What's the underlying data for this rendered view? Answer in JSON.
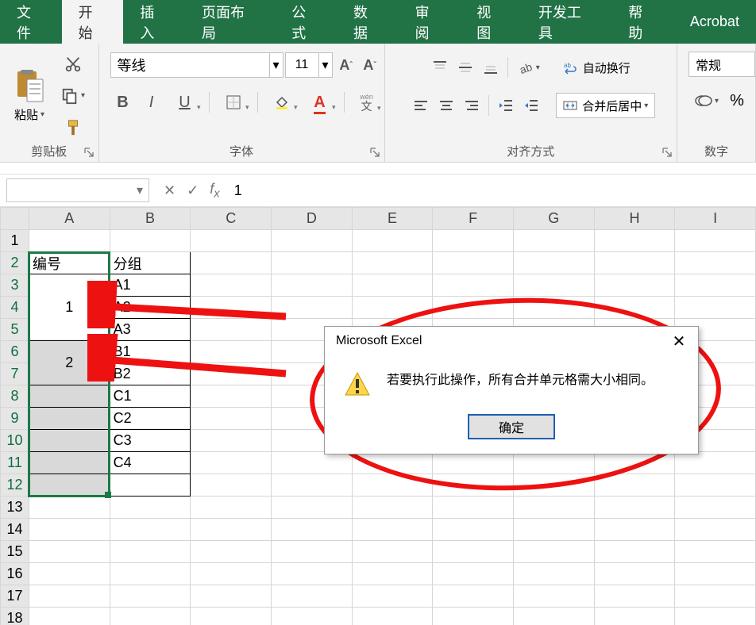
{
  "tabs": {
    "file": "文件",
    "home": "开始",
    "insert": "插入",
    "layout": "页面布局",
    "formula": "公式",
    "data": "数据",
    "review": "审阅",
    "view": "视图",
    "dev": "开发工具",
    "help": "帮助",
    "acro": "Acrobat"
  },
  "ribbon": {
    "paste": "粘贴",
    "clipboard_group": "剪贴板",
    "font_name": "等线",
    "font_size": "11",
    "font_group": "字体",
    "wrap_text": "自动换行",
    "merge_center": "合并后居中",
    "align_group": "对齐方式",
    "number_format": "常规",
    "number_group": "数字",
    "phonetic": "wén 文"
  },
  "namebox": "",
  "formula_value": "1",
  "columns": [
    "A",
    "B",
    "C",
    "D",
    "E",
    "F",
    "G",
    "H",
    "I"
  ],
  "rows_shown": 18,
  "cells": {
    "A2": "编号",
    "B2": "分组",
    "A3_5_merged": "1",
    "A6_7_merged": "2",
    "B3": "A1",
    "B4": "A2",
    "B5": "A3",
    "B6": "B1",
    "B7": "B2",
    "B8": "C1",
    "B9": "C2",
    "B10": "C3",
    "B11": "C4"
  },
  "dialog": {
    "title": "Microsoft Excel",
    "message": "若要执行此操作，所有合并单元格需大小相同。",
    "ok": "确定"
  },
  "colors": {
    "brand": "#217346",
    "select": "#1b7a46",
    "warning": "#f7c400",
    "arrow": "#e11414"
  }
}
